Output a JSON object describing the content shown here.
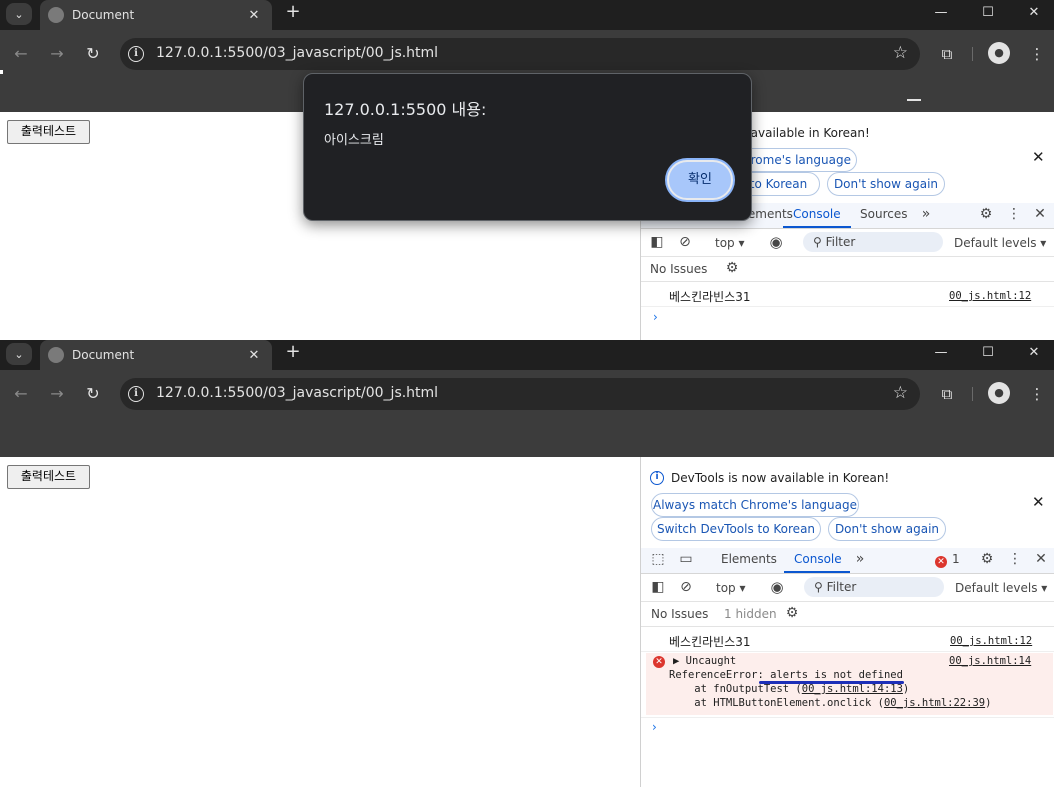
{
  "screenshot_top": {
    "tab_title": "Document",
    "url": "127.0.0.1:5500/03_javascript/00_js.html",
    "page_button": "출력테스트",
    "devtools": {
      "notice_partial": "w available in Korean!",
      "match_partial": "hrome's language",
      "switch_partial": "to Korean",
      "dont_show": "Don't show again",
      "tab_elements_partial": "Elements",
      "tab_console": "Console",
      "tab_sources": "Sources",
      "context": "top ▾",
      "filter": "Filter",
      "levels": "Default levels ▾",
      "no_issues": "No Issues",
      "log": {
        "text": "베스킨라빈스31",
        "source": "00_js.html:12"
      }
    },
    "alert": {
      "title": "127.0.0.1:5500 내용:",
      "message": "아이스크림",
      "ok": "확인"
    }
  },
  "screenshot_bottom": {
    "tab_title": "Document",
    "url": "127.0.0.1:5500/03_javascript/00_js.html",
    "page_button": "출력테스트",
    "devtools": {
      "notice": "DevTools is now available in Korean!",
      "match_btn": "Always match Chrome's language",
      "switch_btn": "Switch DevTools to Korean",
      "dont_show": "Don't show again",
      "tab_elements": "Elements",
      "tab_console": "Console",
      "error_count": "1",
      "context": "top ▾",
      "filter": "Filter",
      "levels": "Default levels ▾",
      "no_issues": "No Issues",
      "hidden": "1 hidden",
      "log": {
        "text": "베스킨라빈스31",
        "source": "00_js.html:12"
      },
      "error": {
        "head": "▶ Uncaught",
        "source": "00_js.html:14",
        "line1_prefix": "ReferenceError: ",
        "line1_msg": "alerts is not defined",
        "line2_prefix": "    at fnOutputTest (",
        "line2_link": "00_js.html:14:13",
        "line2_suffix": ")",
        "line3_prefix": "    at HTMLButtonElement.onclick (",
        "line3_link": "00_js.html:22:39",
        "line3_suffix": ")"
      }
    }
  },
  "colors": {
    "chrome_dark": "#1f1f1f",
    "toolbar": "#3c3c3c",
    "accent_blue": "#0b57d0",
    "error_red": "#dc362e",
    "annotation": "#1d2fb8"
  }
}
